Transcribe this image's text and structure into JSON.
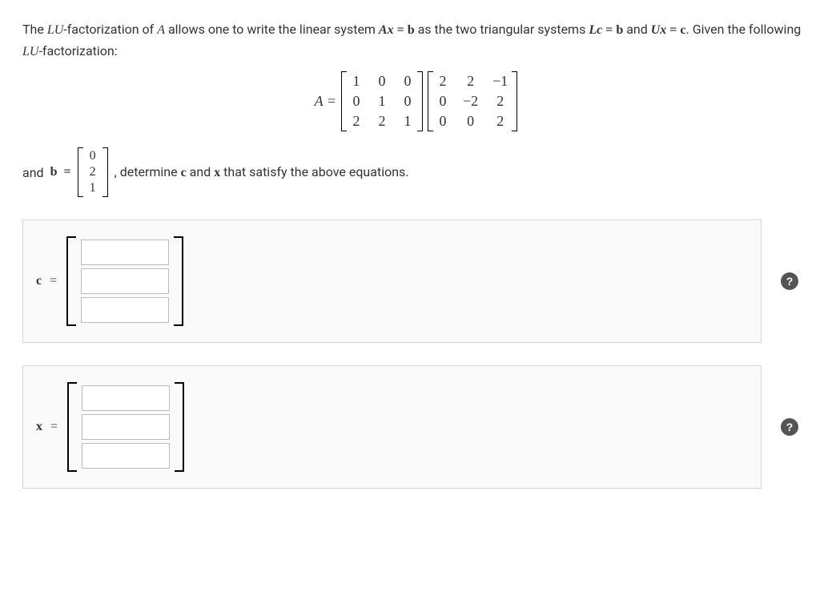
{
  "prose": {
    "p1_a": "The ",
    "p1_b": "-factorization of ",
    "p1_c": " allows one to write the linear system ",
    "p1_d": " as the two triangular systems ",
    "p1_e": " and ",
    "p1_f": ". Given the following ",
    "p1_g": "-factorization:",
    "and": "and ",
    "det": ", determine ",
    "and2": " and ",
    "sat": " that satisfy the above equations."
  },
  "sym": {
    "LU": "LU",
    "A": "A",
    "Ax": "Ax",
    "eq": " = ",
    "b": "b",
    "Lc": "Lc",
    "Ux": "Ux",
    "c": "c",
    "x": "x",
    "Aeq": "A ="
  },
  "matrices": {
    "L": [
      [
        "1",
        "0",
        "0"
      ],
      [
        "0",
        "1",
        "0"
      ],
      [
        "2",
        "2",
        "1"
      ]
    ],
    "U": [
      [
        "2",
        "2",
        "−1"
      ],
      [
        "0",
        "−2",
        "2"
      ],
      [
        "0",
        "0",
        "2"
      ]
    ],
    "bvec": [
      [
        "0"
      ],
      [
        "2"
      ],
      [
        "1"
      ]
    ]
  },
  "answers": {
    "c_label": "c",
    "x_label": "x",
    "eq": "="
  },
  "help": "?"
}
